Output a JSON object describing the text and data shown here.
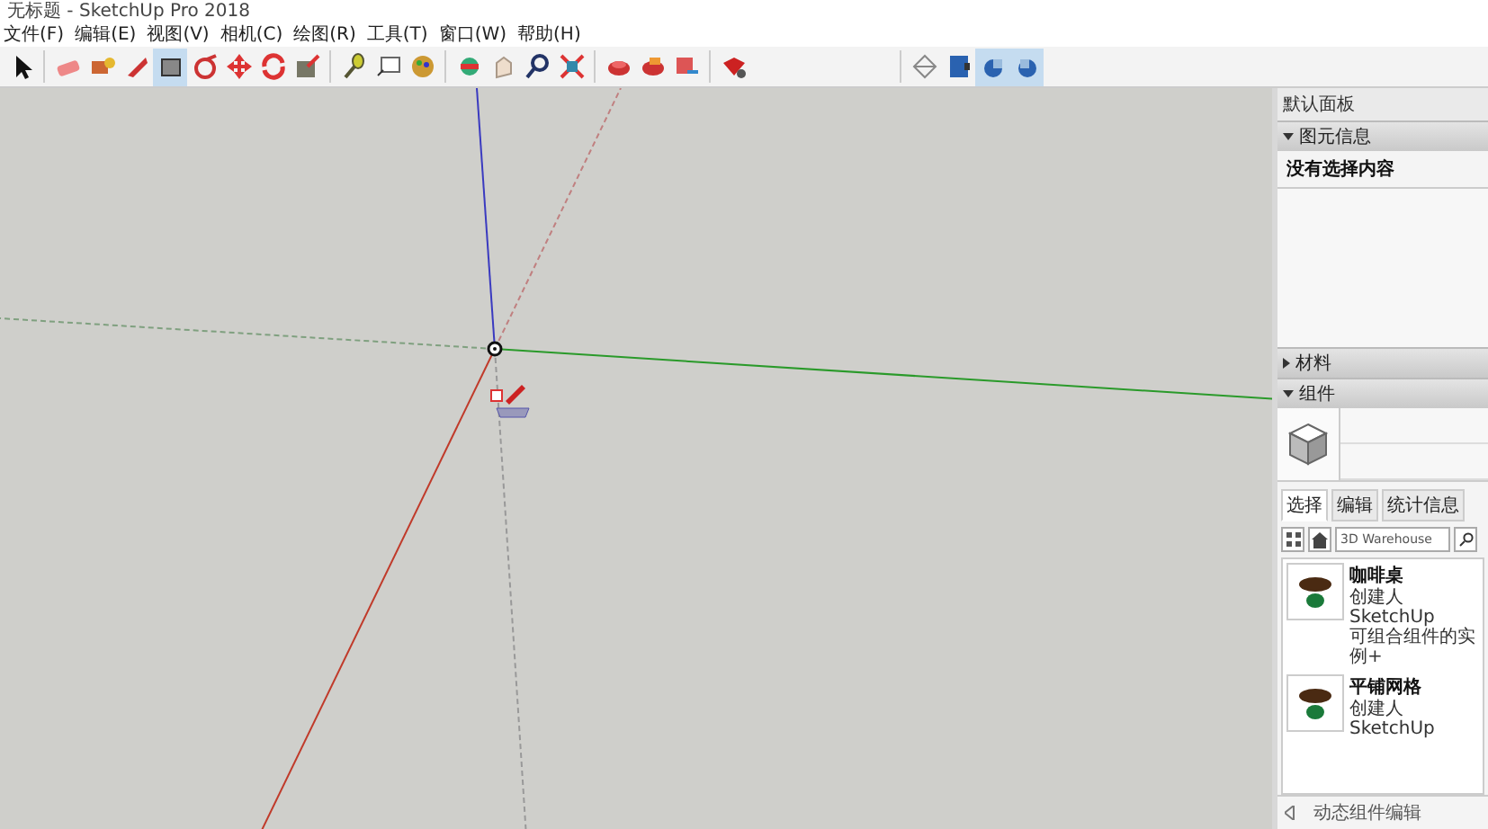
{
  "window": {
    "title": "无标题 - SketchUp Pro 2018"
  },
  "menu": [
    "文件(F)",
    "编辑(E)",
    "视图(V)",
    "相机(C)",
    "绘图(R)",
    "工具(T)",
    "窗口(W)",
    "帮助(H)"
  ],
  "toolbar": {
    "tools": [
      {
        "selected": false
      },
      {
        "selected": false
      },
      {
        "selected": false
      },
      {
        "selected": false
      },
      {
        "selected": true
      },
      {
        "selected": false
      },
      {
        "selected": false
      },
      {
        "selected": false
      },
      {
        "selected": false
      },
      {
        "selected": false
      },
      {
        "selected": false
      },
      {
        "selected": false
      },
      {
        "selected": false
      },
      {
        "selected": false
      },
      {
        "selected": false
      },
      {
        "selected": false
      },
      {
        "selected": false
      },
      {
        "selected": false
      },
      {
        "selected": false
      },
      {
        "selected": false
      }
    ],
    "views": [
      {
        "selected": false
      },
      {
        "selected": false
      },
      {
        "selected": true
      },
      {
        "selected": true
      }
    ]
  },
  "panel": {
    "title": "默认面板",
    "entity_info": {
      "label": "图元信息",
      "expanded": true,
      "message": "没有选择内容"
    },
    "materials": {
      "label": "材料",
      "expanded": false
    },
    "components": {
      "label": "组件",
      "expanded": true,
      "tabs": [
        {
          "label": "选择",
          "selected": true
        },
        {
          "label": "编辑",
          "selected": false
        },
        {
          "label": "统计信息",
          "selected": false
        }
      ],
      "search": {
        "value": "3D Warehouse"
      },
      "items": [
        {
          "name": "咖啡桌",
          "author": "创建人 SketchUp",
          "description": "可组合组件的实例+"
        },
        {
          "name": "平铺网格",
          "author": "创建人 SketchUp"
        }
      ],
      "footer": "动态组件编辑"
    }
  }
}
